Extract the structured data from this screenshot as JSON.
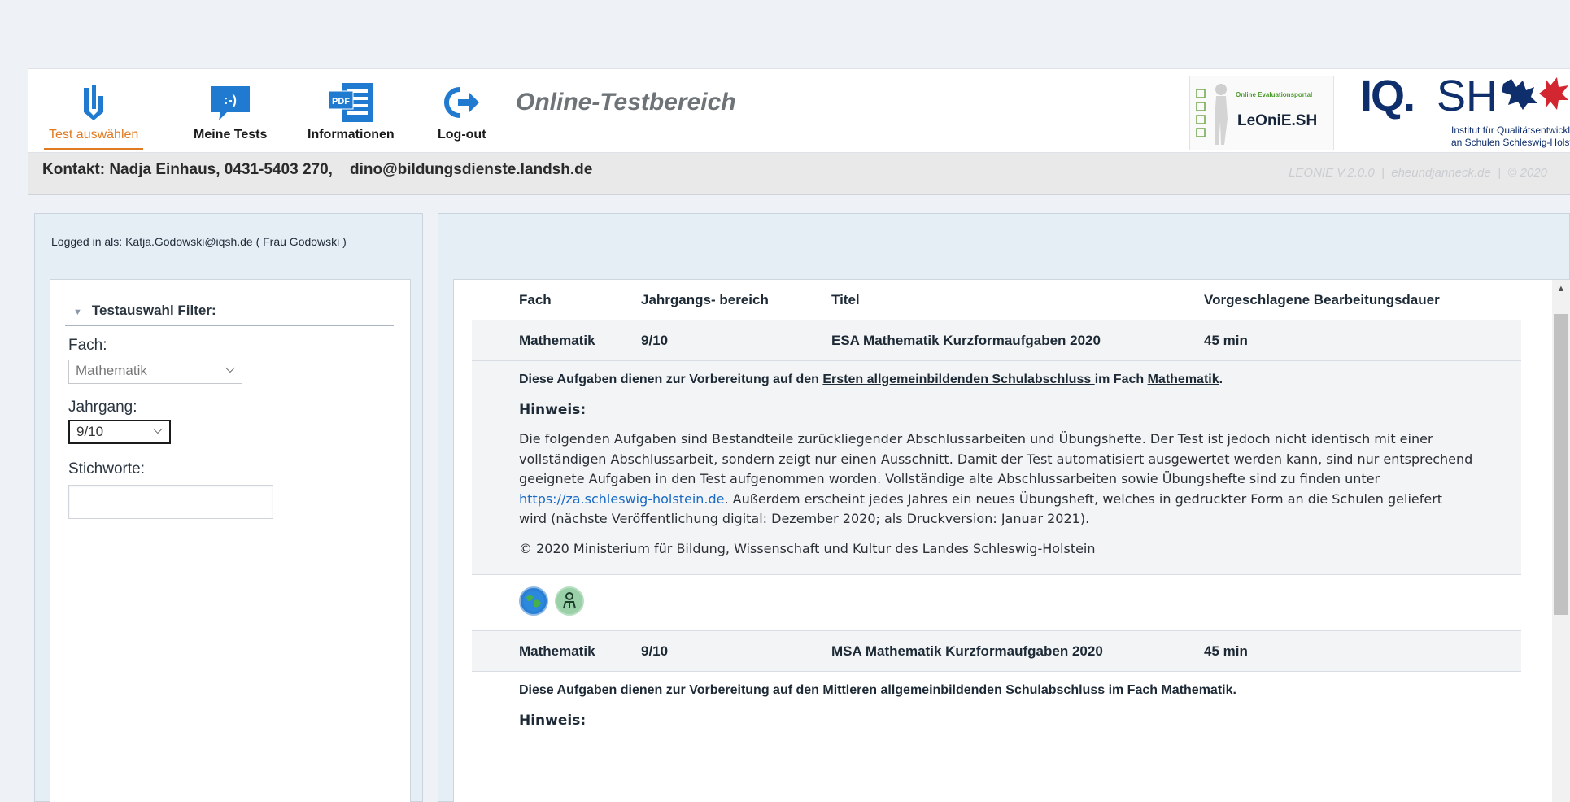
{
  "nav": {
    "items": [
      {
        "label": "Test auswählen",
        "icon": "test-select-icon"
      },
      {
        "label": "Meine Tests",
        "icon": "chat-smiley-icon"
      },
      {
        "label": "Informationen",
        "icon": "pdf-document-icon"
      },
      {
        "label": "Log-out",
        "icon": "logout-arrow-icon"
      }
    ],
    "active_index": 0,
    "accent_color": "#e07b22",
    "icon_color": "#1f7ad0"
  },
  "app_title": "Online-Testbereich",
  "logos": {
    "leonie_small": "Online Evaluationsportal",
    "leonie_big": "LeOniE.SH",
    "iqsh_iq": "IQ.",
    "iqsh_sh": "SH",
    "iqsh_sub1": "Institut für Qualitätsentwickl",
    "iqsh_sub2": "an Schulen Schleswig-Holste"
  },
  "contact": {
    "text": "Kontakt: Nadja Einhaus, 0431-5403 270,    dino@bildungsdienste.landsh.de",
    "version": "LEONIE V.2.0.0  |  eheundjanneck.de  |  © 2020"
  },
  "sidebar": {
    "logged_in": "Logged in als: Katja.Godowski@iqsh.de ( Frau Godowski )",
    "filter_title": "Testauswahl Filter:",
    "fach_label": "Fach:",
    "fach_value": "Mathematik",
    "jahrgang_label": "Jahrgang:",
    "jahrgang_value": "9/10",
    "stichworte_label": "Stichworte:",
    "stichworte_value": ""
  },
  "table": {
    "headers": [
      "Fach",
      "Jahrgangs- bereich",
      "Titel",
      "Vorgeschlagene Bearbeitungsdauer"
    ],
    "rows": [
      {
        "fach": "Mathematik",
        "jahrgang": "9/10",
        "titel": "ESA Mathematik Kurzformaufgaben 2020",
        "dauer": "45 min",
        "intro_pre": "Diese Aufgaben dienen zur Vorbereitung auf den ",
        "intro_link": "Ersten allgemeinbildenden Schulabschluss ",
        "intro_mid": "im Fach ",
        "intro_fach": "Mathematik",
        "intro_end": ".",
        "hinweis": "Hinweis:",
        "body_pre": "Die folgenden Aufgaben sind Bestandteile zurückliegender Abschlussarbeiten und Übungshefte. Der Test ist jedoch nicht identisch mit einer vollständigen Abschlussarbeit, sondern zeigt nur einen Ausschnitt. Damit der Test automatisiert ausgewertet werden kann, sind nur entsprechend geeignete Aufgaben in den Test aufgenommen worden. Vollständige alte Abschlussarbeiten sowie Übungshefte sind zu finden unter ",
        "body_link": "https://za.schleswig-holstein.de",
        "body_post": ". Außerdem erscheint jedes Jahres ein neues Übungsheft, welches in gedruckter Form an die Schulen geliefert wird (nächste Veröffentlichung digital: Dezember 2020; als Druckversion: Januar 2021).",
        "copyright": "© 2020 Ministerium für Bildung, Wissenschaft und Kultur des Landes Schleswig-Holstein"
      },
      {
        "fach": "Mathematik",
        "jahrgang": "9/10",
        "titel": "MSA Mathematik Kurzformaufgaben 2020",
        "dauer": "45 min",
        "intro_pre": "Diese Aufgaben dienen zur Vorbereitung auf den ",
        "intro_link": "Mittleren allgemeinbildenden Schulabschluss ",
        "intro_mid": "im Fach ",
        "intro_fach": "Mathematik",
        "intro_end": ".",
        "hinweis": "Hinweis:"
      }
    ],
    "action_icons": [
      "globe-icon",
      "person-icon"
    ]
  }
}
